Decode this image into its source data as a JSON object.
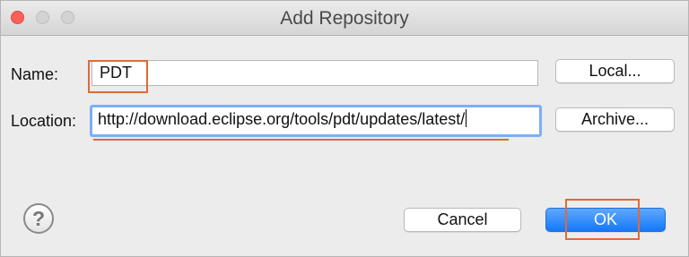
{
  "window": {
    "title": "Add Repository",
    "controls": [
      "close",
      "minimize",
      "maximize"
    ]
  },
  "form": {
    "name_label": "Name:",
    "name_value": "PDT",
    "location_label": "Location:",
    "location_value": "http://download.eclipse.org/tools/pdt/updates/latest/"
  },
  "buttons": {
    "local": "Local...",
    "archive": "Archive...",
    "cancel": "Cancel",
    "ok": "OK",
    "help_symbol": "?"
  },
  "annotations": {
    "color": "#e06a36"
  },
  "colors": {
    "primary_button": "#1478fa",
    "focus_ring": "#7daef5",
    "close_button": "#fc605b"
  }
}
